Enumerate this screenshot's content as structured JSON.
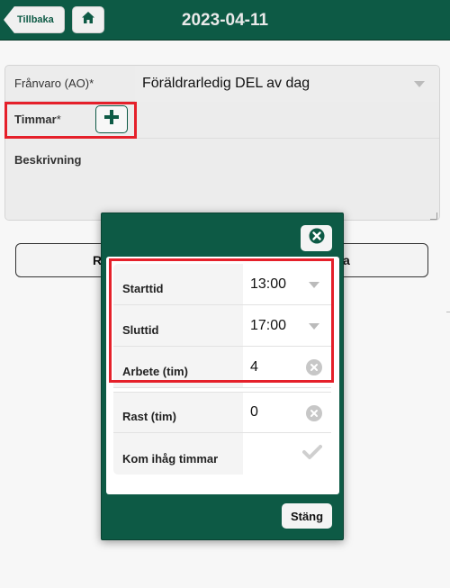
{
  "header": {
    "back_label": "Tillbaka",
    "title": "2023-04-11"
  },
  "form": {
    "absence_label": "Frånvaro (AO)",
    "absence_value": "Föräldrarledig DEL av dag",
    "hours_label": "Timmar",
    "required_mark": "*",
    "description_label": "Beskrivning",
    "description_value": ""
  },
  "background_buttons": {
    "left_label": "R",
    "right_label": "a"
  },
  "modal": {
    "rows": [
      {
        "label": "Starttid",
        "value": "13:00"
      },
      {
        "label": "Sluttid",
        "value": "17:00"
      },
      {
        "label": "Arbete (tim)",
        "value": "4"
      },
      {
        "label": "Rast (tim)",
        "value": "0"
      },
      {
        "label": "Kom ihåg timmar",
        "value": ""
      }
    ],
    "close_label": "Stäng"
  },
  "colors": {
    "brand_green": "#0d5a45",
    "highlight_red": "#e5202a"
  },
  "icons": {
    "back": "chevron-left-icon",
    "home": "home-icon",
    "add": "plus-icon",
    "close": "close-circle-icon",
    "clear": "clear-icon",
    "check": "check-icon",
    "dropdown": "triangle-down-icon"
  }
}
